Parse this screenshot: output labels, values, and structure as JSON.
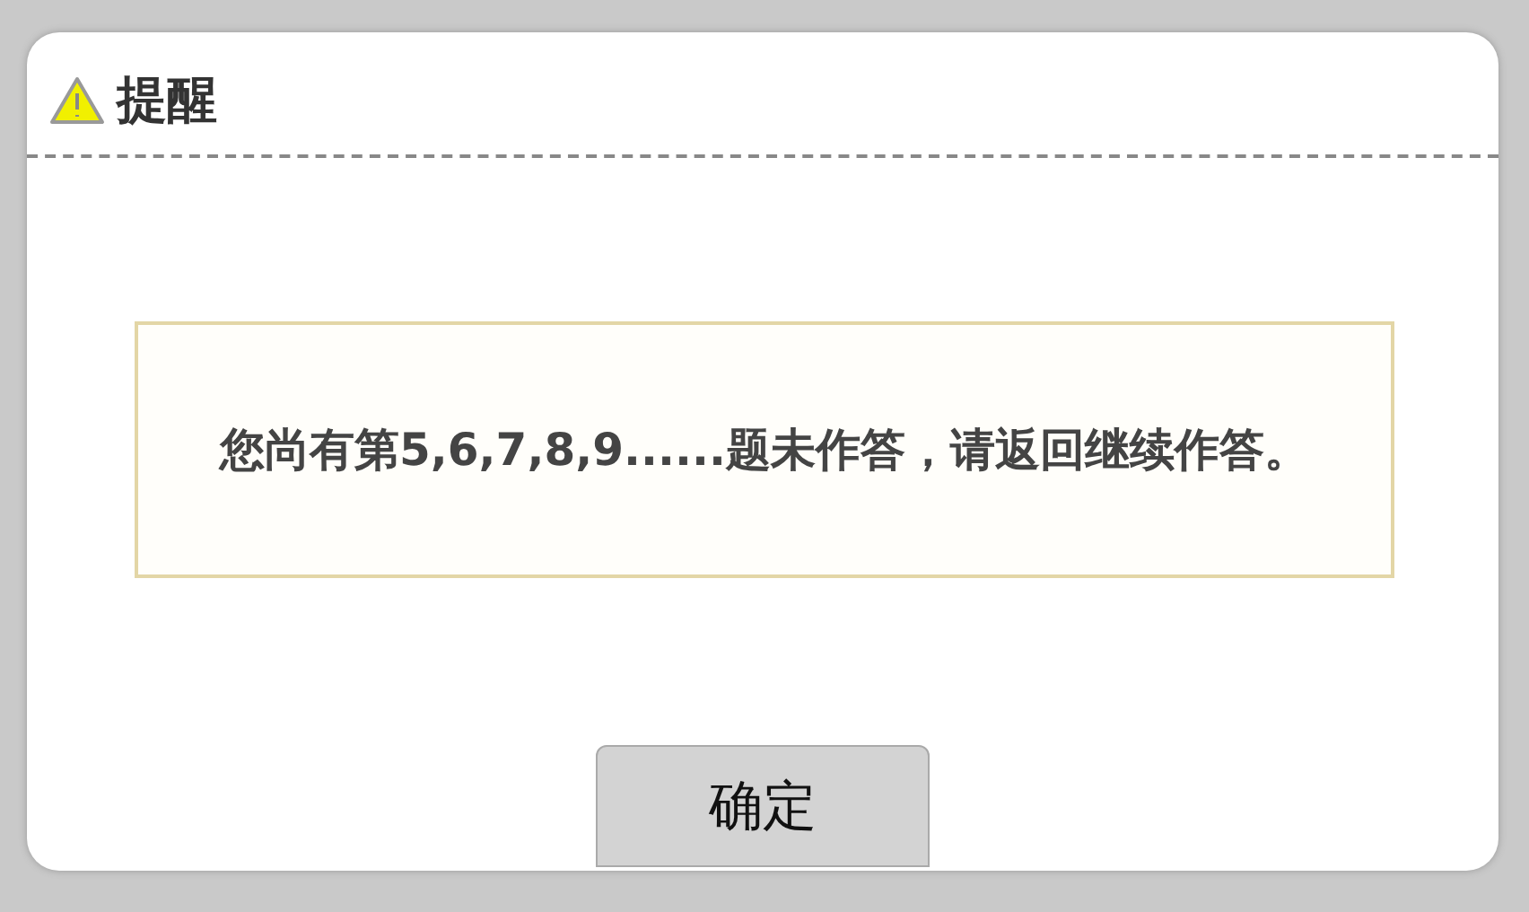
{
  "dialog": {
    "title": "提醒",
    "message": "您尚有第**5,6,7,8,9......**题未作答，请返回继续作答。",
    "buttons": [
      "确定"
    ]
  }
}
